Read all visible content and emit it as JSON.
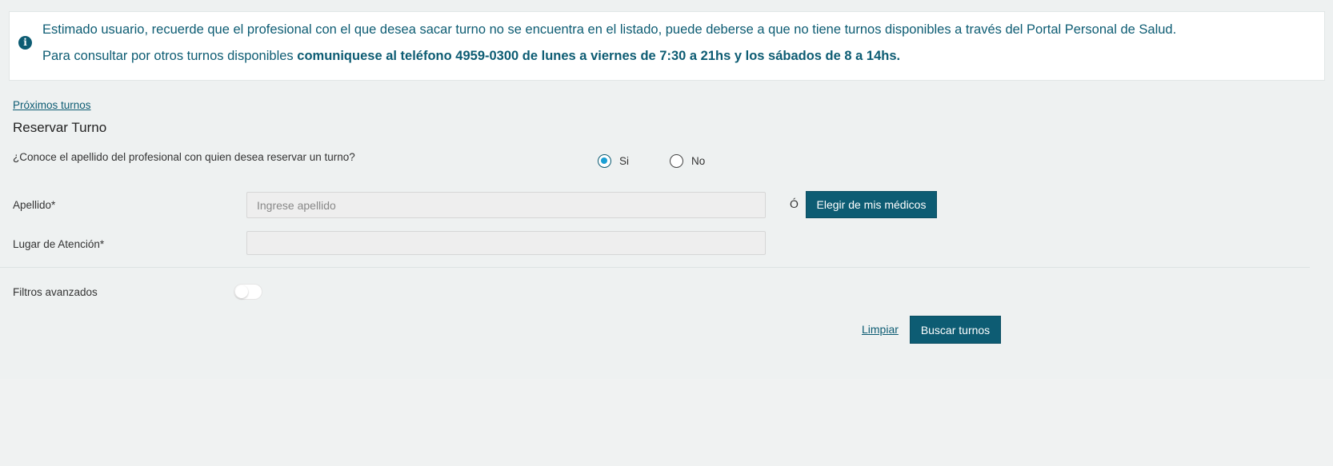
{
  "alert": {
    "icon": "info-icon",
    "line1": "Estimado usuario, recuerde que el profesional con el que desea sacar turno no se encuentra en el listado, puede deberse a que no tiene turnos disponibles a través del Portal Personal de Salud.",
    "line2_prefix": "Para consultar por otros turnos disponibles ",
    "line2_bold": "comuniquese al teléfono 4959-0300 de lunes a viernes de 7:30 a 21hs y los sábados de 8 a 14hs."
  },
  "next_link": "Próximos turnos",
  "section_title": "Reservar Turno",
  "question": {
    "text": "¿Conoce el apellido del profesional con quien desea reservar un turno?",
    "options": [
      {
        "label": "Si",
        "checked": true
      },
      {
        "label": "No",
        "checked": false
      }
    ]
  },
  "fields": {
    "apellido_label": "Apellido*",
    "apellido_placeholder": "Ingrese apellido",
    "apellido_value": "",
    "or_text": "Ó",
    "choose_button": "Elegir de mis médicos",
    "lugar_label": "Lugar de Atención*",
    "lugar_value": ""
  },
  "filters": {
    "label": "Filtros avanzados",
    "enabled": false
  },
  "actions": {
    "clear": "Limpiar",
    "search": "Buscar turnos"
  },
  "colors": {
    "primary": "#0d5c73",
    "background": "#eef1f1",
    "radio_accent": "#1a9fd4"
  }
}
